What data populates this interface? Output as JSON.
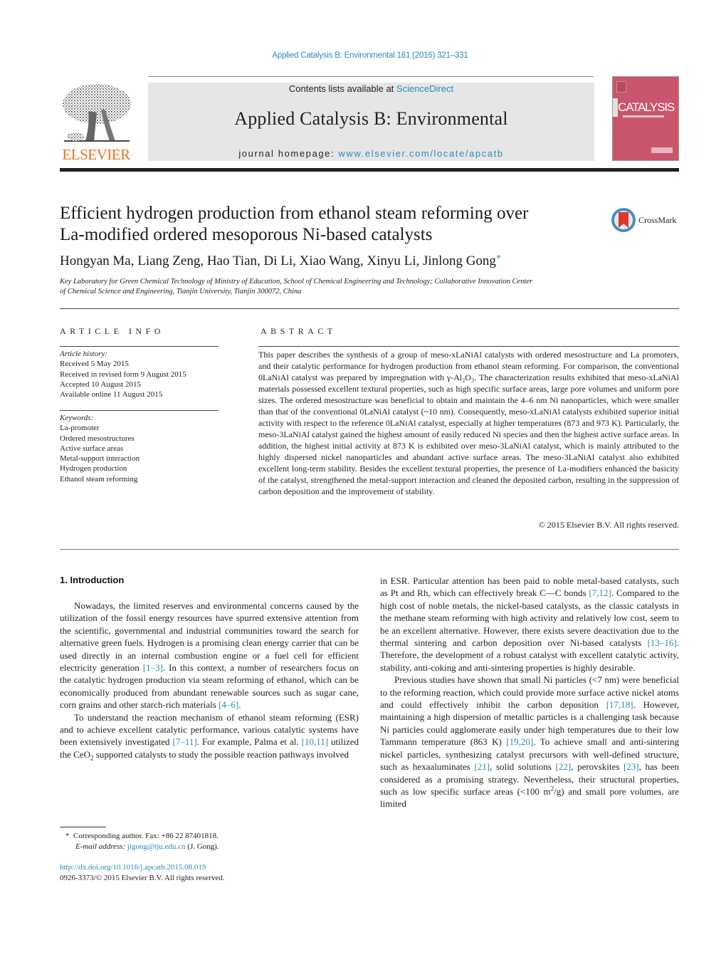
{
  "header": {
    "journal_reference": "Applied Catalysis B: Environmental 181 (2016) 321–331",
    "publisher_logo_text": "ELSEVIER",
    "contents_prefix": "Contents lists available at ",
    "contents_link": "ScienceDirect",
    "journal_title": "Applied Catalysis B: Environmental",
    "homepage_prefix": "journal homepage: ",
    "homepage_link": "www.elsevier.com/locate/apcatb",
    "cover_title": "CATALYSIS",
    "colors": {
      "link": "#2a8ab8",
      "elsevier_orange": "#e9711c",
      "cover": "#c9566b",
      "banner": "#e6e6e6"
    }
  },
  "article": {
    "title_line1": "Efficient hydrogen production from ethanol steam reforming over",
    "title_line2": "La-modified ordered mesoporous Ni-based catalysts",
    "crossmark_label": "CrossMark",
    "authors": "Hongyan Ma, Liang Zeng, Hao Tian, Di Li, Xiao Wang, Xinyu Li, Jinlong Gong",
    "corresponding_mark": "*",
    "affiliation_line1": "Key Laboratory for Green Chemical Technology of Ministry of Education, School of Chemical Engineering and Technology; Collaborative Innovation Center",
    "affiliation_line2": "of Chemical Science and Engineering, Tianjin University, Tianjin 300072, China"
  },
  "article_info": {
    "heading": "ARTICLE INFO",
    "history_label": "Article history:",
    "history": [
      "Received 5 May 2015",
      "Received in revised form 9 August 2015",
      "Accepted 10 August 2015",
      "Available online 11 August 2015"
    ],
    "keywords_label": "Keywords:",
    "keywords": [
      "La-promoter",
      "Ordered mesostructures",
      "Active surface areas",
      "Metal-support interaction",
      "Hydrogen production",
      "Ethanol steam reforming"
    ]
  },
  "abstract": {
    "heading": "ABSTRACT",
    "text": "This paper describes the synthesis of a group of meso-xLaNiAl catalysts with ordered mesostructure and La promoters, and their catalytic performance for hydrogen production from ethanol steam reforming. For comparison, the conventional 0LaNiAl catalyst was prepared by impregnation with γ-Al₂O₃. The characterization results exhibited that meso-xLaNiAl materials possessed excellent textural properties, such as high specific surface areas, large pore volumes and uniform pore sizes. The ordered mesostructure was beneficial to obtain and maintain the 4–6 nm Ni nanoparticles, which were smaller than that of the conventional 0LaNiAl catalyst (~10 nm). Consequently, meso-xLaNiAl catalysts exhibited superior initial activity with respect to the reference 0LaNiAl catalyst, especially at higher temperatures (873 and 973 K). Particularly, the meso-3LaNiAl catalyst gained the highest amount of easily reduced Ni species and then the highest active surface areas. In addition, the highest initial activity at 873 K is exhibited over meso-3LaNiAl catalyst, which is mainly attributed to the highly dispersed nickel nanoparticles and abundant active surface areas. The meso-3LaNiAl catalyst also exhibited excellent long-term stability. Besides the excellent textural properties, the presence of La-modifiers enhanced the basicity of the catalyst, strengthened the metal-support interaction and cleaned the deposited carbon, resulting in the suppression of carbon deposition and the improvement of stability.",
    "copyright": "© 2015 Elsevier B.V. All rights reserved."
  },
  "body": {
    "section_heading": "1.  Introduction",
    "left_p1_a": "Nowadays, the limited reserves and environmental concerns caused by the utilization of the fossil energy resources have spurred extensive attention from the scientific, governmental and industrial communities toward the search for alternative green fuels. Hydrogen is a promising clean energy carrier that can be used directly in an internal combustion engine or a fuel cell for efficient electricity generation ",
    "left_p1_cite1": "[1–3]",
    "left_p1_b": ". In this context, a number of researchers focus on the catalytic hydrogen production via steam reforming of ethanol, which can be economically produced from abundant renewable sources such as sugar cane, corn grains and other starch-rich materials ",
    "left_p1_cite2": "[4–6]",
    "left_p1_c": ".",
    "left_p2_a": "To understand the reaction mechanism of ethanol steam reforming (ESR) and to achieve excellent catalytic performance, various catalytic systems have been extensively investigated ",
    "left_p2_cite1": "[7–11]",
    "left_p2_b": ". For example, Palma et al. ",
    "left_p2_cite2": "[10,11]",
    "left_p2_c": " utilized the CeO",
    "left_p2_sub": "2",
    "left_p2_d": " supported catalysts to study the possible reaction pathways involved",
    "right_p1_a": "in ESR. Particular attention has been paid to noble metal-based catalysts, such as Pt and Rh, which can effectively break C—C bonds ",
    "right_p1_cite1": "[7,12]",
    "right_p1_b": ". Compared to the high cost of noble metals, the nickel-based catalysts, as the classic catalysts in the methane steam reforming with high activity and relatively low cost, seem to be an excellent alternative. However, there exists severe deactivation due to the thermal sintering and carbon deposition over Ni-based catalysts ",
    "right_p1_cite2": "[13–16]",
    "right_p1_c": ". Therefore, the development of a robust catalyst with excellent catalytic activity, stability, anti-coking and anti-sintering properties is highly desirable.",
    "right_p2_a": "Previous studies have shown that small Ni particles (<7 nm) were beneficial to the reforming reaction, which could provide more surface active nickel atoms and could effectively inhibit the carbon deposition ",
    "right_p2_cite1": "[17,18]",
    "right_p2_b": ". However, maintaining a high dispersion of metallic particles is a challenging task because Ni particles could agglomerate easily under high temperatures due to their low Tammann temperature (863 K) ",
    "right_p2_cite2": "[19,20]",
    "right_p2_c": ". To achieve small and anti-sintering nickel particles, synthesizing catalyst precursors with well-defined structure, such as hexaaluminates ",
    "right_p2_cite3": "[21]",
    "right_p2_d": ", solid solutions ",
    "right_p2_cite4": "[22]",
    "right_p2_e": ", perovskites ",
    "right_p2_cite5": "[23]",
    "right_p2_f": ", has been considered as a promising strategy. Nevertheless, their structural properties, such as low specific surface areas (<100 m",
    "right_p2_sup": "2",
    "right_p2_g": "/g) and small pore volumes, are limited"
  },
  "footnotes": {
    "mark": "*",
    "corresponding": "Corresponding author. Fax: +86 22 87401818.",
    "email_label": "E-mail address: ",
    "email": "jlgong@tju.edu.cn",
    "email_suffix": " (J. Gong).",
    "doi": "http://dx.doi.org/10.1016/j.apcatb.2015.08.019",
    "issn": "0926-3373/© 2015 Elsevier B.V. All rights reserved."
  }
}
